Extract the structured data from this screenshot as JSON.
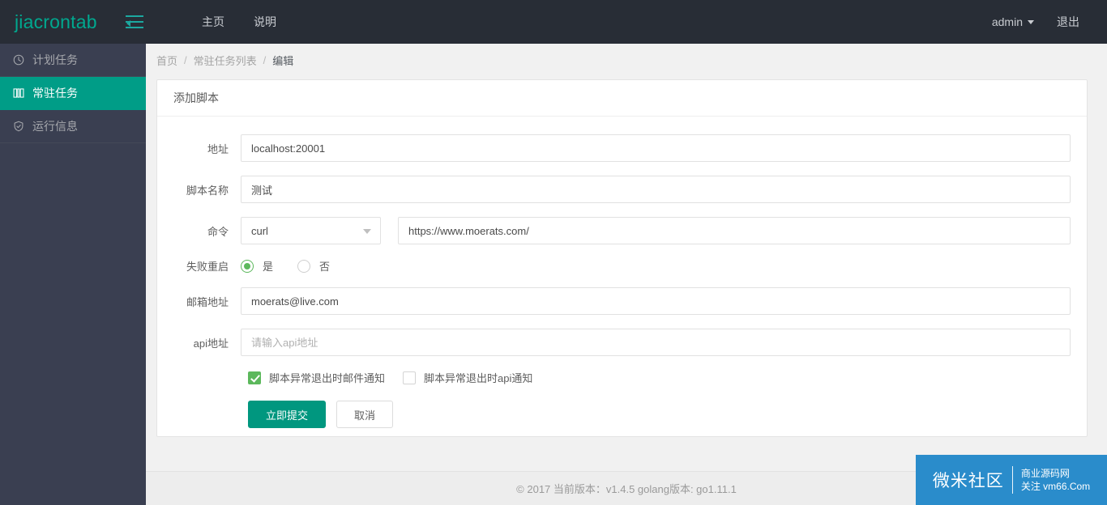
{
  "navbar": {
    "brand": "jiacrontab",
    "toggle_icon": "indent-menu-icon",
    "links": [
      {
        "label": "主页"
      },
      {
        "label": "说明"
      }
    ],
    "user": "admin",
    "logout": "退出"
  },
  "sidebar": {
    "items": [
      {
        "label": "计划任务",
        "icon": "clock-icon",
        "active": false
      },
      {
        "label": "常驻任务",
        "icon": "tasks-icon",
        "active": true
      },
      {
        "label": "运行信息",
        "icon": "shield-icon",
        "active": false
      }
    ]
  },
  "breadcrumb": [
    {
      "label": "首页"
    },
    {
      "label": "常驻任务列表"
    },
    {
      "label": "编辑"
    }
  ],
  "panel": {
    "title": "添加脚本"
  },
  "form": {
    "address": {
      "label": "地址",
      "value": "localhost:20001",
      "placeholder": ""
    },
    "script_name": {
      "label": "脚本名称",
      "value": "测试",
      "placeholder": ""
    },
    "command": {
      "label": "命令",
      "selected": "curl",
      "options": [
        "curl"
      ],
      "arg_value": "https://www.moerats.com/",
      "arg_placeholder": ""
    },
    "fail_restart": {
      "label": "失败重启",
      "options": [
        {
          "label": "是",
          "selected": true
        },
        {
          "label": "否",
          "selected": false
        }
      ]
    },
    "mail_address": {
      "label": "邮箱地址",
      "value": "moerats@live.com",
      "placeholder": ""
    },
    "api_address": {
      "label": "api地址",
      "value": "",
      "placeholder": "请输入api地址"
    },
    "checkboxes": [
      {
        "label": "脚本异常退出时邮件通知",
        "checked": true
      },
      {
        "label": "脚本异常退出时api通知",
        "checked": false
      }
    ],
    "submit_label": "立即提交",
    "cancel_label": "取消"
  },
  "footer": {
    "text": "© 2017 当前版本：v1.4.5 golang版本: go1.11.1"
  },
  "watermark": {
    "main": "微米社区",
    "sub_line1": "商业源码网",
    "sub_line2": "关注 vm66.Com"
  },
  "colors": {
    "navbar_bg": "#282d36",
    "sidebar_bg": "#3a3f51",
    "accent_green": "#009d87",
    "button_green": "#00977f",
    "check_green": "#5cb85c",
    "watermark_blue": "#2a8ccb"
  }
}
